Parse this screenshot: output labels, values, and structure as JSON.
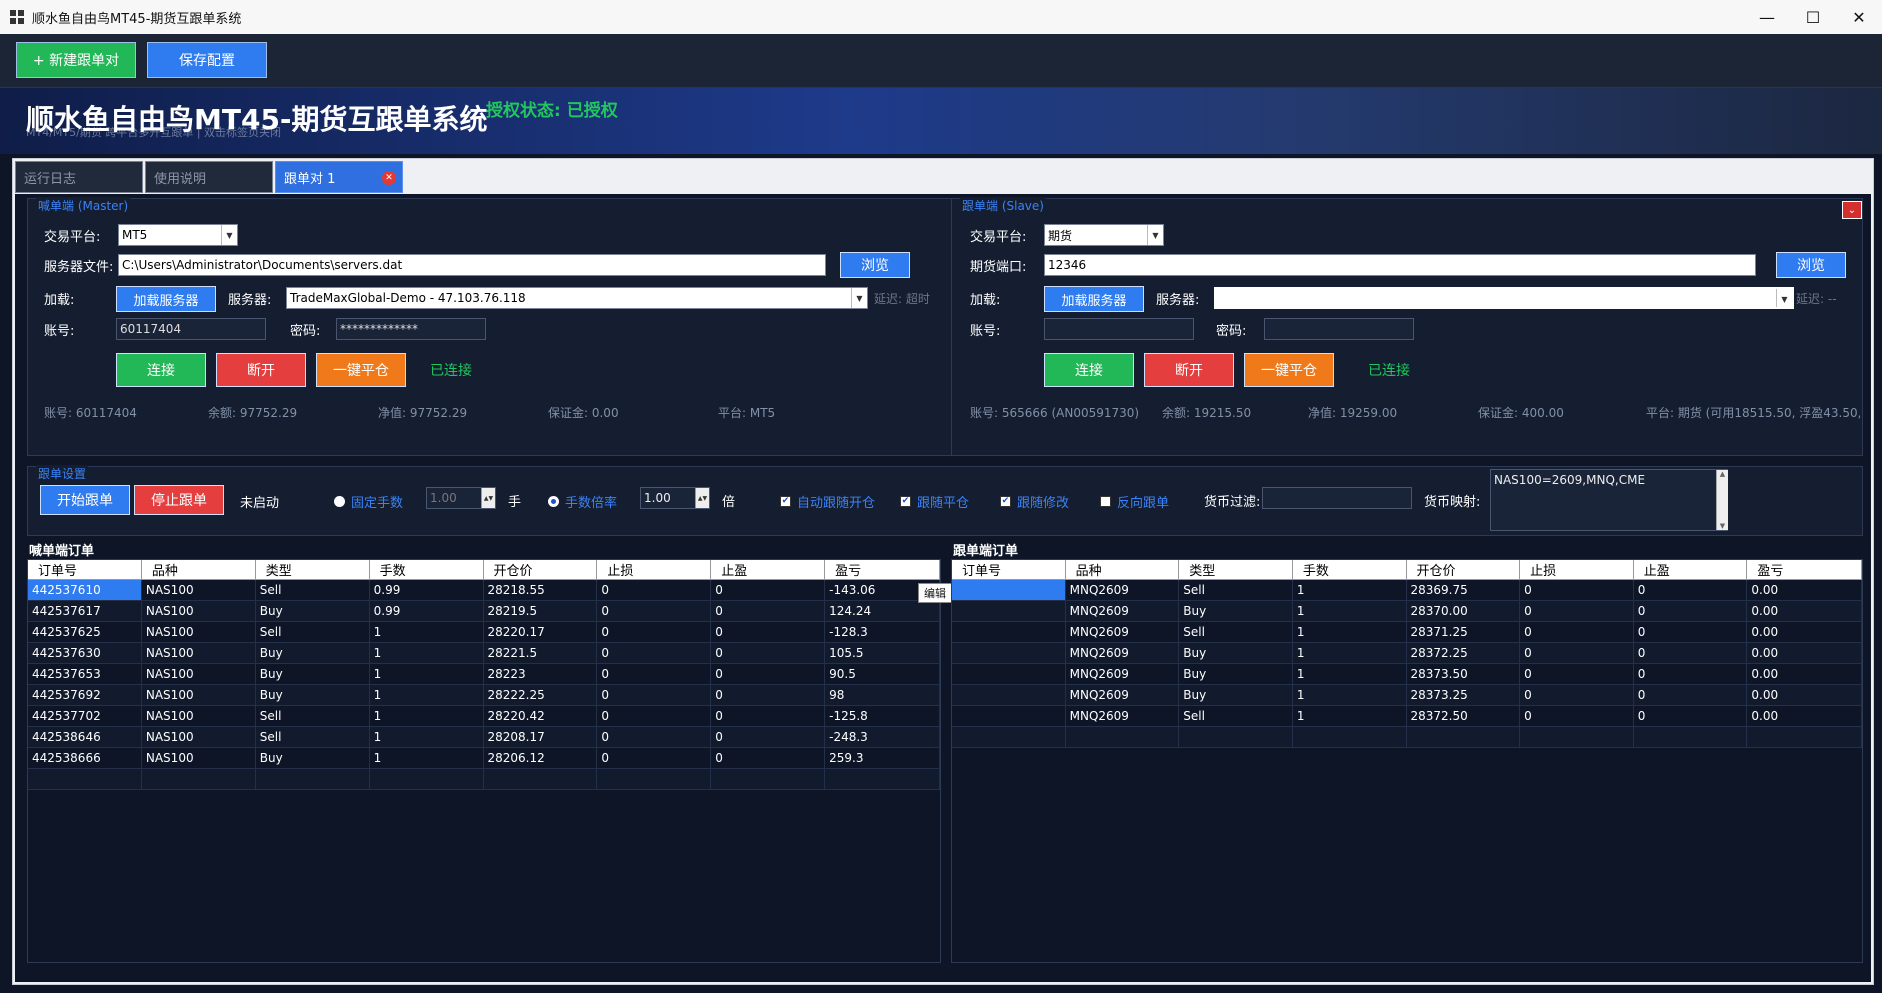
{
  "window": {
    "title": "顺水鱼自由鸟MT45-期货互跟单系统",
    "minimize": "—",
    "maximize": "☐",
    "close": "✕"
  },
  "toolbar": {
    "new_pair": "+ 新建跟单对",
    "save_config": "保存配置"
  },
  "banner": {
    "title": "顺水鱼自由鸟MT45-期货互跟单系统",
    "subtitle": "MT4/MT5/期货 跨平台多开互跟单 | 双击标签页关闭",
    "auth_status": "授权状态: 已授权"
  },
  "tabs": [
    {
      "label": "运行日志"
    },
    {
      "label": "使用说明"
    },
    {
      "label": "跟单对 1"
    }
  ],
  "master": {
    "group_title": "喊单端 (Master)",
    "platform_label": "交易平台:",
    "platform_value": "MT5",
    "server_file_label": "服务器文件:",
    "server_file_value": "C:\\Users\\Administrator\\Documents\\servers.dat",
    "browse": "浏览",
    "load_label": "加载:",
    "load_button": "加载服务器",
    "server_label": "服务器:",
    "server_value": "TradeMaxGlobal-Demo - 47.103.76.118",
    "delay": "延迟: 超时",
    "account_label": "账号:",
    "account_value": "60117404",
    "password_label": "密码:",
    "password_value": "*************",
    "connect": "连接",
    "disconnect": "断开",
    "close_all": "一键平仓",
    "status": "已连接",
    "info": {
      "account": "账号: 60117404",
      "balance": "余额: 97752.29",
      "equity": "净值: 97752.29",
      "margin": "保证金: 0.00",
      "platform": "平台: MT5"
    }
  },
  "slave": {
    "group_title": "跟单端 (Slave)",
    "platform_label": "交易平台:",
    "platform_value": "期货",
    "port_label": "期货端口:",
    "port_value": "12346",
    "browse": "浏览",
    "load_label": "加载:",
    "load_button": "加载服务器",
    "server_label": "服务器:",
    "server_value": "",
    "delay": "延迟: --",
    "account_label": "账号:",
    "account_value": "",
    "password_label": "密码:",
    "password_value": "",
    "connect": "连接",
    "disconnect": "断开",
    "close_all": "一键平仓",
    "status": "已连接",
    "info": {
      "account": "账号: 565666 (AN00591730)",
      "balance": "余额: 19215.50",
      "equity": "净值: 19259.00",
      "margin": "保证金: 400.00",
      "platform": "平台: 期货 (可用18515.50, 浮盈43.50,"
    }
  },
  "settings": {
    "group_title": "跟单设置",
    "start": "开始跟单",
    "stop": "停止跟单",
    "state": "未启动",
    "fixed_lot": "固定手数",
    "fixed_lot_value": "1.00",
    "lot_unit": "手",
    "multiplier": "手数倍率",
    "multiplier_value": "1.00",
    "multiplier_unit": "倍",
    "auto_open_close": "自动跟随开仓",
    "follow_close": "跟随平仓",
    "follow_modify": "跟随修改",
    "reverse": "反向跟单",
    "currency_filter_label": "货币过滤:",
    "currency_filter_value": "",
    "currency_map_label": "货币映射:",
    "currency_map_value": "NAS100=2609,MNQ,CME"
  },
  "master_orders": {
    "title": "喊单端订单",
    "columns": [
      "订单号",
      "品种",
      "类型",
      "手数",
      "开仓价",
      "止损",
      "止盈",
      "盈亏"
    ],
    "rows": [
      [
        "442537610",
        "NAS100",
        "Sell",
        "0.99",
        "28218.55",
        "0",
        "0",
        "-143.06"
      ],
      [
        "442537617",
        "NAS100",
        "Buy",
        "0.99",
        "28219.5",
        "0",
        "0",
        "124.24"
      ],
      [
        "442537625",
        "NAS100",
        "Sell",
        "1",
        "28220.17",
        "0",
        "0",
        "-128.3"
      ],
      [
        "442537630",
        "NAS100",
        "Buy",
        "1",
        "28221.5",
        "0",
        "0",
        "105.5"
      ],
      [
        "442537653",
        "NAS100",
        "Buy",
        "1",
        "28223",
        "0",
        "0",
        "90.5"
      ],
      [
        "442537692",
        "NAS100",
        "Buy",
        "1",
        "28222.25",
        "0",
        "0",
        "98"
      ],
      [
        "442537702",
        "NAS100",
        "Sell",
        "1",
        "28220.42",
        "0",
        "0",
        "-125.8"
      ],
      [
        "442538646",
        "NAS100",
        "Sell",
        "1",
        "28208.17",
        "0",
        "0",
        "-248.3"
      ],
      [
        "442538666",
        "NAS100",
        "Buy",
        "1",
        "28206.12",
        "0",
        "0",
        "259.3"
      ],
      [
        "",
        "",
        "",
        "",
        "",
        "",
        "",
        ""
      ]
    ],
    "tooltip": "编辑"
  },
  "slave_orders": {
    "title": "跟单端订单",
    "columns": [
      "订单号",
      "品种",
      "类型",
      "手数",
      "开仓价",
      "止损",
      "止盈",
      "盈亏"
    ],
    "rows": [
      [
        "",
        "MNQ2609",
        "Sell",
        "1",
        "28369.75",
        "0",
        "0",
        "0.00"
      ],
      [
        "",
        "MNQ2609",
        "Buy",
        "1",
        "28370.00",
        "0",
        "0",
        "0.00"
      ],
      [
        "",
        "MNQ2609",
        "Sell",
        "1",
        "28371.25",
        "0",
        "0",
        "0.00"
      ],
      [
        "",
        "MNQ2609",
        "Buy",
        "1",
        "28372.25",
        "0",
        "0",
        "0.00"
      ],
      [
        "",
        "MNQ2609",
        "Buy",
        "1",
        "28373.50",
        "0",
        "0",
        "0.00"
      ],
      [
        "",
        "MNQ2609",
        "Buy",
        "1",
        "28373.25",
        "0",
        "0",
        "0.00"
      ],
      [
        "",
        "MNQ2609",
        "Sell",
        "1",
        "28372.50",
        "0",
        "0",
        "0.00"
      ],
      [
        "",
        "",
        "",
        "",
        "",
        "",
        "",
        ""
      ]
    ]
  },
  "colors": {
    "accent": "#2f7bf0",
    "success": "#22c55e",
    "danger": "#e53e3e",
    "warning": "#f07a1a",
    "background": "#0d1527"
  }
}
